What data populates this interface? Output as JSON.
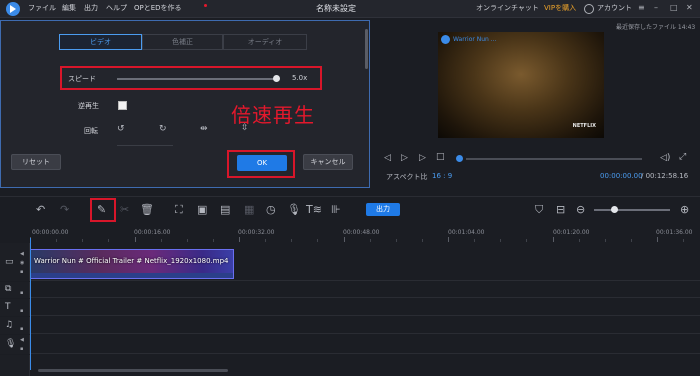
{
  "app": {
    "title": "名称未設定",
    "menus": [
      "ファイル",
      "編集",
      "出力",
      "ヘルプ",
      "OPとEDを作る"
    ],
    "online_chat": "オンラインチャット",
    "vip": "VIPを購入",
    "account": "アカウント"
  },
  "edit_panel": {
    "tabs": [
      "ビデオ",
      "色補正",
      "オーディオ"
    ],
    "active_tab": "ビデオ",
    "speed_label": "スピード",
    "speed_value": "5.0x",
    "speed_fraction": 1.0,
    "reverse_label": "逆再生",
    "reverse_checked": false,
    "rotate_label": "回転",
    "annotation": "倍速再生",
    "reset_label": "リセット",
    "ok_label": "OK",
    "cancel_label": "キャンセル"
  },
  "preview": {
    "autosave": "最近保存したファイル 14:43",
    "video_caption": "Warrior Nun ...",
    "watermark": "NETFLIX",
    "aspect_label": "アスペクト比",
    "aspect_value": "16 : 9",
    "current_time": "00:00:00.00",
    "total_time": "/ 00:12:58.16"
  },
  "toolbar": {
    "export_label": "出力"
  },
  "timeline": {
    "ruler": [
      "00:00:00.00",
      "00:00:16.00",
      "00:00:32.00",
      "00:00:48.00",
      "00:01:04.00",
      "00:01:20.00",
      "00:01:36.00"
    ],
    "clip_label": "Warrior Nun # Official Trailer # Netflix_1920x1080.mp4"
  },
  "colors": {
    "accent": "#1f7ae6",
    "highlight_red": "#d8162a",
    "vip": "#f0a52a"
  }
}
